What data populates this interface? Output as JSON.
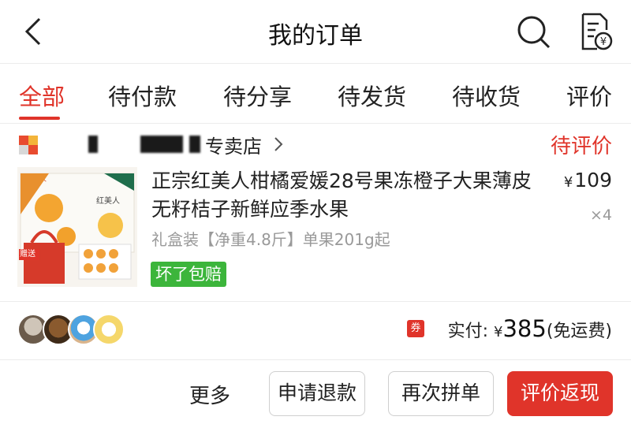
{
  "header": {
    "title": "我的订单"
  },
  "tabs": [
    {
      "label": "全部",
      "active": true
    },
    {
      "label": "待付款"
    },
    {
      "label": "待分享"
    },
    {
      "label": "待发货"
    },
    {
      "label": "待收货"
    },
    {
      "label": "评价"
    }
  ],
  "shop": {
    "name": "专卖店",
    "status": "待评价"
  },
  "product": {
    "title": "正宗红美人柑橘爱媛28号果冻橙子大果薄皮无籽桔子新鲜应季水果",
    "price_symbol": "¥",
    "price": "109",
    "quantity": "×4",
    "spec": "礼盒装【净重4.8斤】单果201g起",
    "badge": "坏了包赔",
    "thumb_label": "赠送"
  },
  "summary": {
    "coupon_icon": "券",
    "paid_label": "实付:",
    "currency": "¥",
    "amount": "385",
    "shipping_note": "(免运费)"
  },
  "actions": {
    "more": "更多",
    "refund": "申请退款",
    "reorder": "再次拼单",
    "review": "评价返现"
  },
  "colors": {
    "accent": "#e0342a",
    "badge": "#3cb53b"
  },
  "icons": [
    "back-icon",
    "search-icon",
    "invoice-icon",
    "chevron-right-icon",
    "coupon-icon"
  ]
}
